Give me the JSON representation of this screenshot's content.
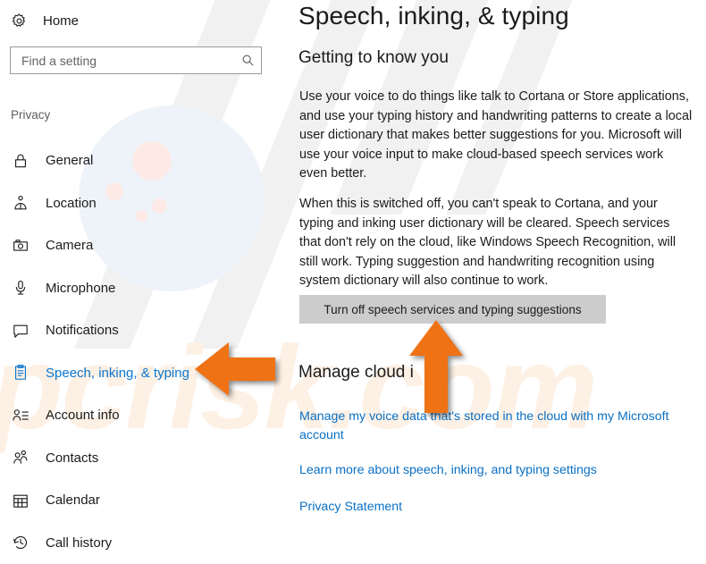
{
  "sidebar": {
    "home": {
      "label": "Home",
      "icon": "gear-icon"
    },
    "search": {
      "value": "",
      "placeholder": "Find a setting",
      "icon": "search-icon"
    },
    "group_label": "Privacy",
    "items": [
      {
        "label": "General",
        "icon": "lock-icon",
        "selected": false
      },
      {
        "label": "Location",
        "icon": "location-pin-icon",
        "selected": false
      },
      {
        "label": "Camera",
        "icon": "camera-icon",
        "selected": false
      },
      {
        "label": "Microphone",
        "icon": "microphone-icon",
        "selected": false
      },
      {
        "label": "Notifications",
        "icon": "speech-bubble-icon",
        "selected": false
      },
      {
        "label": "Speech, inking, & typing",
        "icon": "clipboard-icon",
        "selected": true
      },
      {
        "label": "Account info",
        "icon": "contact-card-icon",
        "selected": false
      },
      {
        "label": "Contacts",
        "icon": "people-icon",
        "selected": false
      },
      {
        "label": "Calendar",
        "icon": "calendar-icon",
        "selected": false
      },
      {
        "label": "Call history",
        "icon": "history-icon",
        "selected": false
      }
    ]
  },
  "main": {
    "page_title": "Speech, inking, & typing",
    "section_heading": "Getting to know you",
    "paragraph_1": "Use your voice to do things like talk to Cortana or Store applications, and use your typing history and handwriting patterns to create a local user dictionary that makes better suggestions for you. Microsoft will use your voice input to make cloud-based speech services work even better.",
    "paragraph_2": "When this is switched off, you can't speak to Cortana, and your typing and inking user dictionary will be cleared. Speech services that don't rely on the cloud, like Windows Speech Recognition, will still work. Typing suggestion and handwriting recognition using system dictionary will also continue to work.",
    "turn_off_button": "Turn off speech services and typing suggestions",
    "manage_heading": "Manage cloud i",
    "links": [
      "Manage my voice data that's stored in the cloud with my Microsoft account",
      "Learn more about speech, inking, and typing settings",
      "Privacy Statement"
    ]
  },
  "annotations": {
    "arrow_left": "arrow-left-icon",
    "arrow_up": "arrow-up-icon",
    "arrow_color": "#ef7215"
  },
  "watermark": {
    "text": "pcrisk.com",
    "color": "#fdf0e4"
  },
  "colors": {
    "accent": "#0b76d0",
    "link": "#0b70c4",
    "text": "#1b1b1b",
    "button_bg": "#cccccc",
    "arrow": "#ef7215"
  }
}
